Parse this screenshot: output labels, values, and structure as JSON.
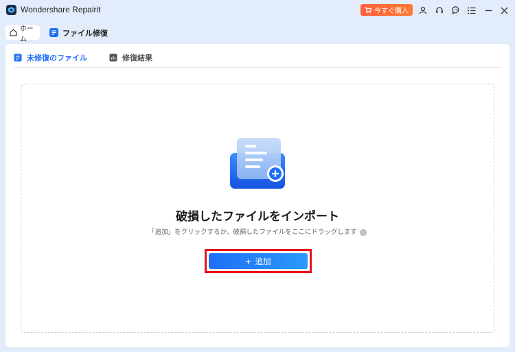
{
  "window": {
    "app_name": "Wondershare Repairit",
    "buy_label": "今すぐ購入"
  },
  "tabs": {
    "home_label": "ホーム",
    "repair_label": "ファイル修復"
  },
  "subtabs": {
    "active_label": "未修復のファイル",
    "results_label": "修復結果"
  },
  "dropzone": {
    "title": "破損したファイルをインポート",
    "hint": "「追加」をクリックするか、破損したファイルをここにドラッグします",
    "info_glyph": "!",
    "add_label": "追加",
    "add_glyph": "+"
  },
  "colors": {
    "accent": "#1e6ef5",
    "buy": "#ff6a35",
    "highlight": "#e8101c"
  }
}
